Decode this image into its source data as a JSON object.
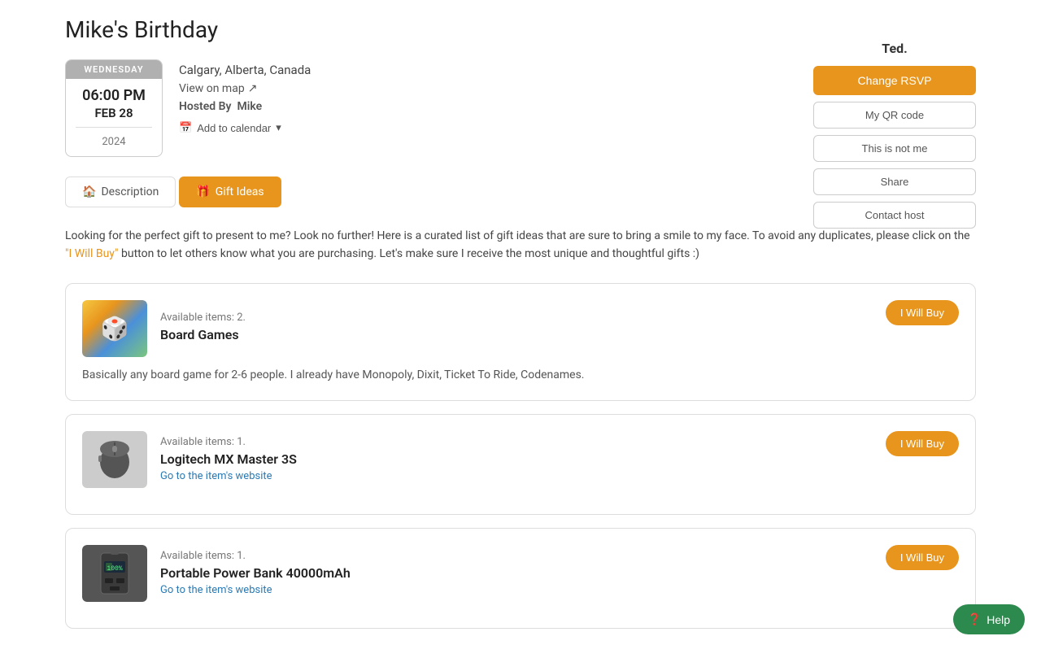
{
  "page": {
    "title": "Mike's Birthday"
  },
  "date_card": {
    "day_label": "WEDNESDAY",
    "time": "06:00 PM",
    "date": "FEB 28",
    "year": "2024"
  },
  "event": {
    "location": "Calgary, Alberta, Canada",
    "map_link": "View on map",
    "hosted_by_label": "Hosted By",
    "hosted_by_name": "Mike",
    "add_to_calendar": "Add to calendar"
  },
  "rsvp": {
    "user_name": "Ted.",
    "change_rsvp_label": "Change RSVP",
    "my_qr_code_label": "My QR code",
    "this_is_not_me_label": "This is not me",
    "share_label": "Share",
    "contact_host_label": "Contact host"
  },
  "tabs": {
    "description_label": "Description",
    "gift_ideas_label": "Gift Ideas"
  },
  "gift_intro": {
    "text_before": "Looking for the perfect gift to present to me? Look no further! Here is a curated list of gift ideas that are sure to bring a smile to my face. To avoid any duplicates, please click on the ",
    "highlight": "\"I Will Buy\"",
    "text_after": " button to let others know what you are purchasing. Let's make sure I receive the most unique and thoughtful gifts :)"
  },
  "gifts": [
    {
      "id": 1,
      "available_label": "Available items: 2.",
      "name": "Board Games",
      "description": "Basically any board game for 2-6 people. I already have Monopoly, Dixit, Ticket To Ride, Codenames.",
      "has_link": false,
      "image_type": "board-games",
      "buy_label": "I Will Buy"
    },
    {
      "id": 2,
      "available_label": "Available items: 1.",
      "name": "Logitech MX Master 3S",
      "description": "",
      "link_text": "Go to the item's website",
      "has_link": true,
      "image_type": "mouse",
      "buy_label": "I Will Buy"
    },
    {
      "id": 3,
      "available_label": "Available items: 1.",
      "name": "Portable Power Bank 40000mAh",
      "description": "",
      "link_text": "Go to the item's website",
      "has_link": true,
      "image_type": "powerbank",
      "buy_label": "I Will Buy"
    }
  ],
  "help_button": {
    "label": "Help"
  }
}
